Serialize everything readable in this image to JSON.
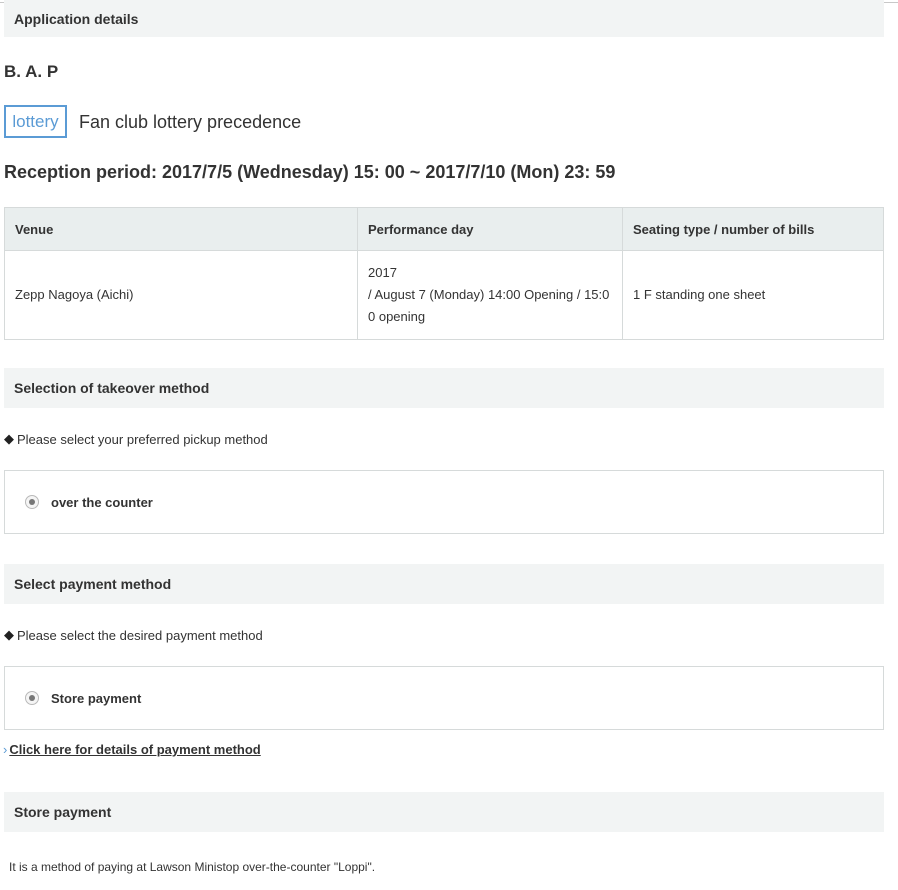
{
  "app_details": {
    "title": "Application details"
  },
  "artist": "B. A. P",
  "badge": {
    "label": "lottery",
    "description": "Fan club lottery precedence"
  },
  "reception_period": "Reception period: 2017/7/5 (Wednesday) 15: 00 ~ 2017/7/10 (Mon) 23: 59",
  "table": {
    "headers": [
      "Venue",
      "Performance day",
      "Seating type / number of bills"
    ],
    "row": {
      "venue": "Zepp Nagoya (Aichi)",
      "day_line1": "2017",
      "day_line2": "/ August 7 (Monday) 14:00 Opening / 15:0",
      "day_line3": "0 opening",
      "seating": "1 F standing one sheet"
    }
  },
  "takeover": {
    "title": "Selection of takeover method",
    "instruction": "Please select your preferred pickup method",
    "option": "over the counter"
  },
  "payment": {
    "title": "Select payment method",
    "instruction": "Please select the desired payment method",
    "option": "Store payment",
    "details_link": "Click here for details of payment method"
  },
  "store_payment": {
    "title": "Store payment",
    "note": "It is a method of paying at Lawson Ministop over-the-counter \"Loppi\"."
  },
  "icons": {
    "diamond": "diamond-bullet-icon",
    "radio": "radio-selected-icon",
    "chevron": "chevron-right-icon"
  },
  "colors": {
    "accent": "#5b9bd5",
    "section_bg": "#f2f4f4",
    "table_header_bg": "#e9eeee"
  }
}
